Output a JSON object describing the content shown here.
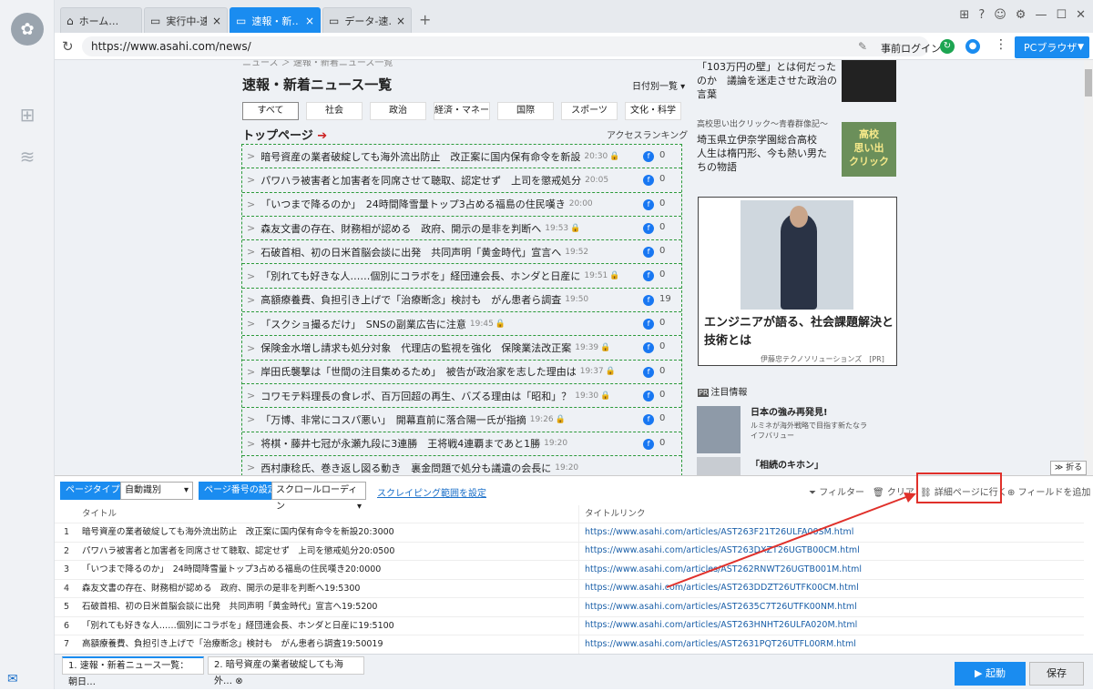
{
  "tabs": [
    {
      "label": "ホーム…",
      "icon": "home-icon",
      "active": false
    },
    {
      "label": "実行中-速…",
      "icon": "page-icon",
      "active": false
    },
    {
      "label": "速報・新…",
      "icon": "page-icon",
      "active": true
    },
    {
      "label": "データ-速…",
      "icon": "page-icon",
      "active": false
    }
  ],
  "address": {
    "url": "https://www.asahi.com/news/",
    "prelogin": "事前ログイン",
    "pcbrowser": "PCブラウザ"
  },
  "page": {
    "breadcrumb": "ニュース ＞ 速報・新着ニュース一覧",
    "title": "速報・新着ニュース一覧",
    "date_select": "日付別一覧",
    "categories": [
      "すべて",
      "社会",
      "政治",
      "経済・マネー",
      "国際",
      "スポーツ",
      "文化・科学"
    ],
    "top_heading": "トップページ",
    "access_ranking": "アクセスランキング",
    "news": [
      {
        "text": "暗号資産の業者破綻しても海外流出防止　改正案に国内保有命令を新設",
        "time": "20:30",
        "lock": true,
        "count": "0"
      },
      {
        "text": "パワハラ被害者と加害者を同席させて聴取、認定せず　上司を懲戒処分",
        "time": "20:05",
        "lock": false,
        "count": "0"
      },
      {
        "text": "「いつまで降るのか」　24時間降雪量トップ3占める福島の住民嘆き",
        "time": "20:00",
        "lock": false,
        "count": "0"
      },
      {
        "text": "森友文書の存在、財務相が認める　政府、開示の是非を判断へ",
        "time": "19:53",
        "lock": true,
        "count": "0"
      },
      {
        "text": "石破首相、初の日米首脳会談に出発　共同声明「黄金時代」宣言へ",
        "time": "19:52",
        "lock": false,
        "count": "0"
      },
      {
        "text": "「別れても好きな人……個別にコラボを」経団連会長、ホンダと日産に",
        "time": "19:51",
        "lock": true,
        "count": "0"
      },
      {
        "text": "高額療養費、負担引き上げで「治療断念」検討も　がん患者ら調査",
        "time": "19:50",
        "lock": false,
        "count": "19"
      },
      {
        "text": "「スクショ撮るだけ」　SNSの副業広告に注意",
        "time": "19:45",
        "lock": true,
        "count": "0"
      },
      {
        "text": "保険金水増し請求も処分対象　代理店の監視を強化　保険業法改正案",
        "time": "19:39",
        "lock": true,
        "count": "0"
      },
      {
        "text": "岸田氏襲撃は「世間の注目集めるため」　被告が政治家を志した理由は",
        "time": "19:37",
        "lock": true,
        "count": "0"
      },
      {
        "text": "コワモテ料理長の食レポ、百万回超の再生、バズる理由は「昭和」？",
        "time": "19:30",
        "lock": true,
        "count": "0"
      },
      {
        "text": "「万博、非常にコスパ悪い」　開幕直前に落合陽一氏が指摘",
        "time": "19:26",
        "lock": true,
        "count": "0"
      },
      {
        "text": "将棋・藤井七冠が永瀬九段に3連勝　王将戦4連覇まであと1勝",
        "time": "19:20",
        "lock": false,
        "count": "0"
      },
      {
        "text": "西村康稔氏、巻き返し図る動き　裏金問題で処分も議遺の会長に",
        "time": "19:20",
        "lock": false,
        "count": ""
      }
    ],
    "right": {
      "item1": "「103万円の壁」とは何だったのか　議論を迷走させた政治の言葉",
      "item2_kicker": "高校思い出クリック〜青春群像記〜",
      "item2": "埼玉県立伊奈学園総合高校　人生は楕円形、今も熱い男たちの物語",
      "img2_text": "高校\n思い出\nクリック",
      "ad_title": "エンジニアが語る、社会課題解決と技術とは",
      "ad_sub": "伊藤忠テクノソリューションズ　[PR]",
      "pr_label": "PR",
      "pr_heading": "注目情報",
      "pr1_title": "日本の強み再発見!",
      "pr1_sub": "ルミネが海外戦略で目指す新たなライフバリュー",
      "pr2_title": "「相続のキホン」"
    },
    "fold": "折る"
  },
  "panel": {
    "page_type_label": "ページタイプ",
    "page_type_value": "自動識別",
    "page_num_label": "ページ番号の設定",
    "page_num_value": "スクロールローディン",
    "scrape_range": "スクレイピング範囲を設定",
    "filter": "フィルター",
    "clear": "クリア",
    "detail": "詳細ページに行く",
    "add_field": "フィールドを追加",
    "col_title": "タイトル",
    "col_link": "タイトルリンク",
    "rows": [
      {
        "n": "1",
        "t": "暗号資産の業者破綻しても海外流出防止　改正案に国内保有命令を新設20:3000",
        "l": "https://www.asahi.com/articles/AST263F21T26ULFA00SM.html"
      },
      {
        "n": "2",
        "t": "パワハラ被害者と加害者を同席させて聴取、認定せず　上司を懲戒処分20:0500",
        "l": "https://www.asahi.com/articles/AST263DXZT26UGTB00CM.html"
      },
      {
        "n": "3",
        "t": "「いつまで降るのか」　24時間降雪量トップ3占める福島の住民嘆き20:0000",
        "l": "https://www.asahi.com/articles/AST262RNWT26UGTB001M.html"
      },
      {
        "n": "4",
        "t": "森友文書の存在、財務相が認める　政府、開示の是非を判断へ19:5300",
        "l": "https://www.asahi.com/articles/AST263DDZT26UTFK00CM.html"
      },
      {
        "n": "5",
        "t": "石破首相、初の日米首脳会談に出発　共同声明「黄金時代」宣言へ19:5200",
        "l": "https://www.asahi.com/articles/AST2635C7T26UTFK00NM.html"
      },
      {
        "n": "6",
        "t": "「別れても好きな人……個別にコラボを」経団連会長、ホンダと日産に19:5100",
        "l": "https://www.asahi.com/articles/AST263HNHT26ULFA020M.html"
      },
      {
        "n": "7",
        "t": "高額療養費、負担引き上げで「治療断念」検討も　がん患者ら調査19:50019",
        "l": "https://www.asahi.com/articles/AST2631PQT26UTFL00RM.html"
      }
    ]
  },
  "bottom": {
    "tab1": "1. 速報・新着ニュース一覧：朝日…",
    "tab2": "2. 暗号資産の業者破綻しても海外…",
    "start": "起動",
    "save": "保存"
  }
}
